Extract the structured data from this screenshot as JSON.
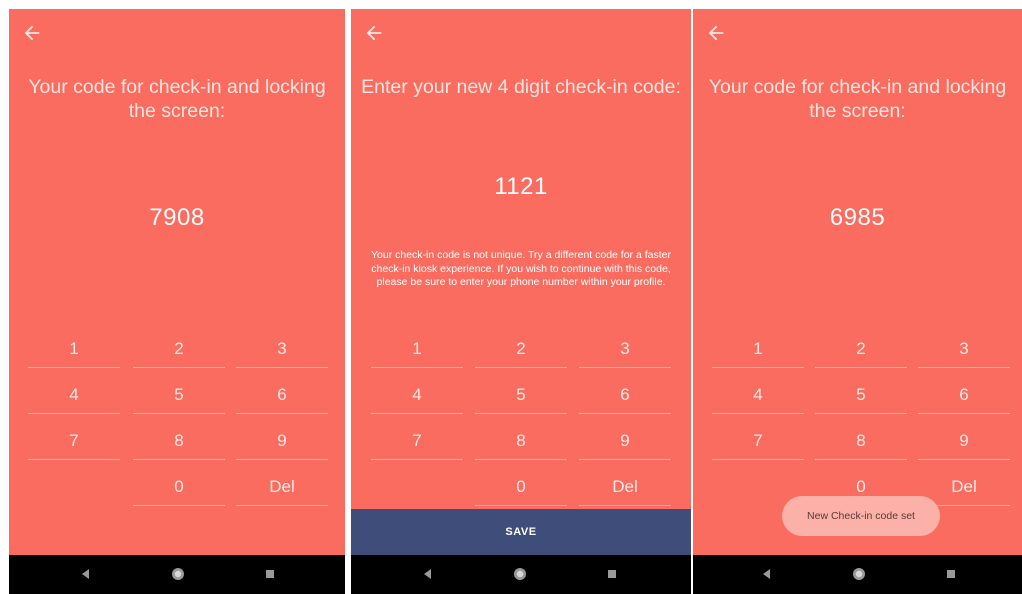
{
  "colors": {
    "screen_bg": "#f96c5f",
    "save_bar": "#3f4d7b",
    "toast_bg": "#fbb1a8",
    "nav_bg": "#000000"
  },
  "screens": [
    {
      "back_icon": "arrow-left-icon",
      "title": "Your code for check-in and locking the screen:",
      "code": "7908",
      "keypad": [
        "1",
        "2",
        "3",
        "4",
        "5",
        "6",
        "7",
        "8",
        "9",
        "",
        "0",
        "Del"
      ]
    },
    {
      "back_icon": "arrow-left-icon",
      "title": "Enter your new 4 digit check-in code:",
      "code": "1121",
      "warning": "Your check-in code is not unique. Try a different code for a faster check-in kiosk experience. If you wish to continue with this code, please be sure to enter your phone number within your profile.",
      "keypad": [
        "1",
        "2",
        "3",
        "4",
        "5",
        "6",
        "7",
        "8",
        "9",
        "",
        "0",
        "Del"
      ],
      "save_label": "SAVE"
    },
    {
      "back_icon": "arrow-left-icon",
      "title": "Your code for check-in and locking the screen:",
      "code": "6985",
      "keypad": [
        "1",
        "2",
        "3",
        "4",
        "5",
        "6",
        "7",
        "8",
        "9",
        "",
        "0",
        "Del"
      ],
      "toast": "New Check-in code set"
    }
  ],
  "navbar": {
    "icons": [
      "nav-back-icon",
      "nav-home-icon",
      "nav-recents-icon"
    ]
  }
}
